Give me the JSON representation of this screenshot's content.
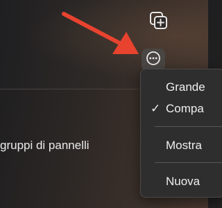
{
  "toolbar": {
    "new_tab_group_icon": "new-tab-group-icon",
    "more_icon": "ellipsis-circle-icon"
  },
  "annotation": {
    "arrow_color": "#e8432f"
  },
  "content": {
    "text": "gruppi di pannelli"
  },
  "menu": {
    "items": [
      {
        "label": "Grande",
        "checked": false
      },
      {
        "label": "Compa",
        "checked": true,
        "check_mark": "✓"
      },
      {
        "label": "Mostra",
        "checked": false
      },
      {
        "label": "Nuova",
        "checked": false
      }
    ]
  }
}
